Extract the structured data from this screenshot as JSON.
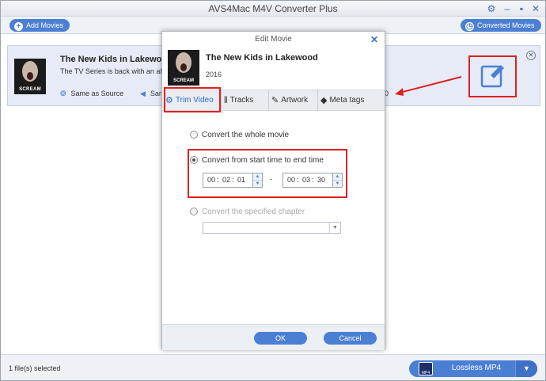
{
  "window": {
    "title": "AVS4Mac M4V Converter Plus"
  },
  "toolbar": {
    "add_movies": "Add Movies",
    "converted_movies": "Converted Movies"
  },
  "movie": {
    "title": "The New Kids in Lakewood",
    "description": "The TV Series is back with an all-n",
    "quality": "Same as Source",
    "audio": "Sam",
    "right_value": "0",
    "thumb_text": "SCREAM"
  },
  "dialog": {
    "title": "Edit Movie",
    "movie_title": "The New Kids in Lakewood",
    "year": "2016",
    "tabs": [
      {
        "label": "Trim Video",
        "icon": "gear-icon"
      },
      {
        "label": "Tracks",
        "icon": "waveform-icon"
      },
      {
        "label": "Artwork",
        "icon": "palette-icon"
      },
      {
        "label": "Meta tags",
        "icon": "tag-icon"
      }
    ],
    "options": {
      "whole": "Convert the whole movie",
      "range": "Convert from start time to end time",
      "chapter": "Convert the specified chapter"
    },
    "start_time": {
      "h": "00",
      "m": "02",
      "s": "01"
    },
    "end_time": {
      "h": "00",
      "m": "03",
      "s": "30"
    },
    "dash": "-",
    "ok": "OK",
    "cancel": "Cancel"
  },
  "status": {
    "selected": "1 file(s) selected",
    "format": "Lossless MP4",
    "format_badge": "MP4"
  },
  "colors": {
    "accent": "#4a7fd4",
    "highlight": "#e0201f"
  }
}
